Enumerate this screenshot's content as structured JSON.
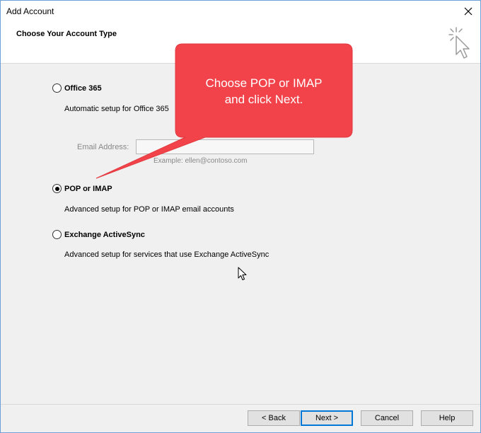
{
  "window": {
    "title": "Add Account",
    "header_title": "Choose Your Account Type"
  },
  "options": {
    "office365": {
      "label": "Office 365",
      "description": "Automatic setup for Office 365",
      "checked": false
    },
    "email": {
      "label": "Email Address:",
      "value": "",
      "example": "Example: ellen@contoso.com"
    },
    "pop_imap": {
      "label": "POP or IMAP",
      "description": "Advanced setup for POP or IMAP email accounts",
      "checked": true
    },
    "activesync": {
      "label": "Exchange ActiveSync",
      "description": "Advanced setup for services that use Exchange ActiveSync",
      "checked": false
    }
  },
  "callout": {
    "line1": "Choose POP or IMAP",
    "line2": "and click Next.",
    "color": "#f2434a"
  },
  "buttons": {
    "back": "< Back",
    "next": "Next >",
    "cancel": "Cancel",
    "help": "Help"
  },
  "icons": {
    "close": "close-icon",
    "wizard": "cursor-sparkle-icon",
    "pointer": "mouse-pointer-icon"
  }
}
